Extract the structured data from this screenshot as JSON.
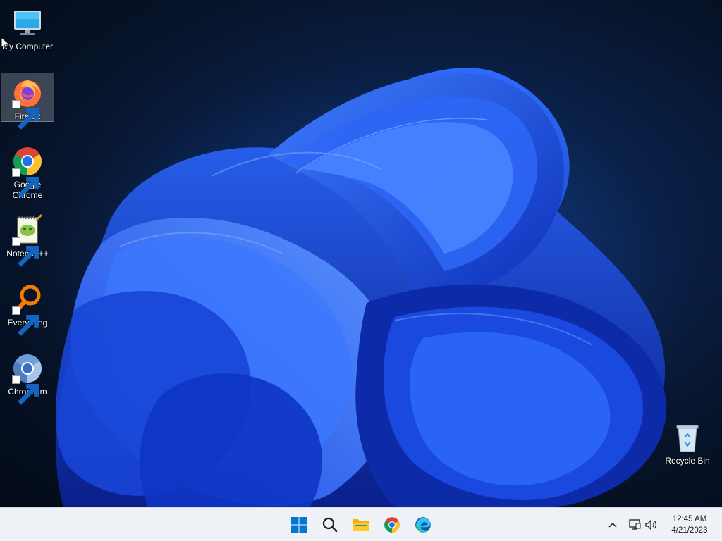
{
  "desktop": {
    "icons": [
      {
        "label": "My Computer",
        "icon": "monitor-icon"
      },
      {
        "label": "Firefox",
        "icon": "firefox-icon",
        "shortcut": true
      },
      {
        "label": "Google\nChrome",
        "icon": "chrome-icon",
        "shortcut": true
      },
      {
        "label": "Notepad++",
        "icon": "notepad-plus-plus-icon",
        "shortcut": true
      },
      {
        "label": "Everything",
        "icon": "everything-search-icon",
        "shortcut": true
      },
      {
        "label": "Chromium",
        "icon": "chromium-icon",
        "shortcut": true
      }
    ],
    "recycle_bin": {
      "label": "Recycle Bin",
      "icon": "recycle-bin-icon"
    }
  },
  "taskbar": {
    "apps": [
      {
        "name": "Start",
        "icon": "windows-start-icon"
      },
      {
        "name": "Search",
        "icon": "search-icon"
      },
      {
        "name": "File Explorer",
        "icon": "folder-icon"
      },
      {
        "name": "Google Chrome",
        "icon": "chrome-icon"
      },
      {
        "name": "Microsoft Edge",
        "icon": "edge-icon"
      }
    ],
    "tray": {
      "icons": [
        "chevron-up-icon",
        "network-icon",
        "volume-icon"
      ]
    },
    "clock": {
      "time": "12:45 AM",
      "date": "4/21/2023"
    }
  },
  "colors": {
    "wallpaper_dark": "#061227",
    "bloom_blue": "#1f5ff5",
    "taskbar_bg": "#eef1f6",
    "accent": "#0078d4"
  }
}
